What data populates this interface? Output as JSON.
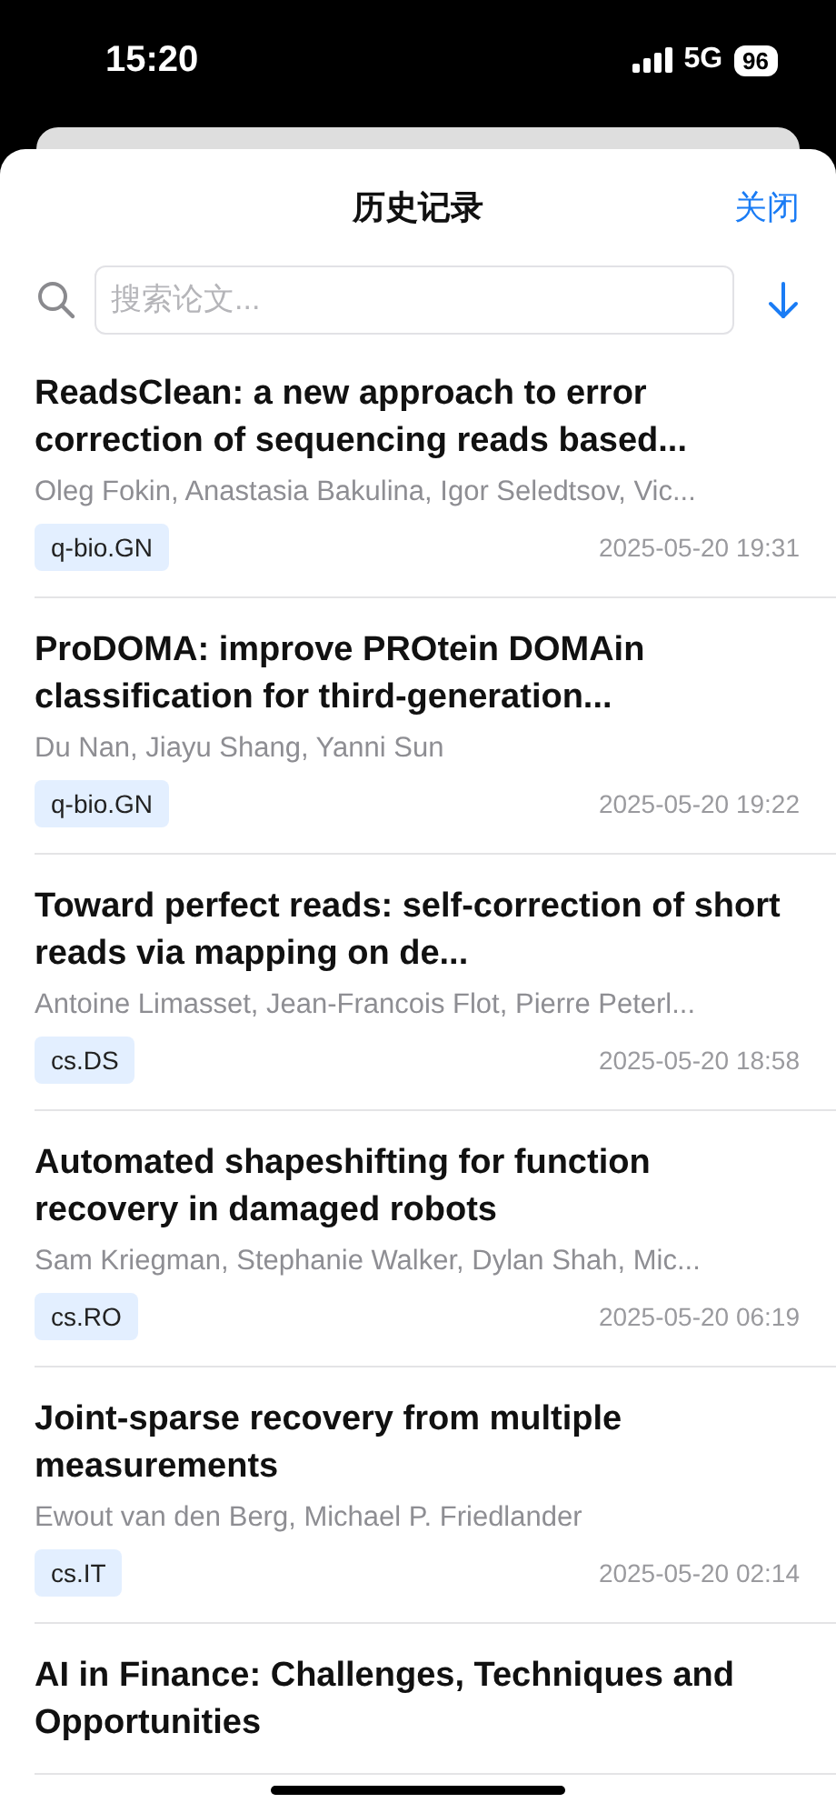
{
  "status_bar": {
    "time": "15:20",
    "network": "5G",
    "battery": "96"
  },
  "header": {
    "title": "历史记录",
    "close": "关闭"
  },
  "search": {
    "placeholder": "搜索论文..."
  },
  "papers": [
    {
      "title": "ReadsClean: a new approach to error correction of sequencing reads based...",
      "authors": "Oleg Fokin, Anastasia Bakulina, Igor Seledtsov, Vic...",
      "category": "q-bio.GN",
      "date": "2025-05-20 19:31"
    },
    {
      "title": "ProDOMA: improve PROtein DOMAin classification for third-generation...",
      "authors": "Du Nan, Jiayu Shang, Yanni Sun",
      "category": "q-bio.GN",
      "date": "2025-05-20 19:22"
    },
    {
      "title": "Toward perfect reads: self-correction of short reads via mapping on de...",
      "authors": "Antoine Limasset, Jean-Francois Flot, Pierre Peterl...",
      "category": "cs.DS",
      "date": "2025-05-20 18:58"
    },
    {
      "title": "Automated shapeshifting for function recovery in damaged robots",
      "authors": "Sam Kriegman, Stephanie Walker, Dylan Shah, Mic...",
      "category": "cs.RO",
      "date": "2025-05-20 06:19"
    },
    {
      "title": "Joint-sparse recovery from multiple measurements",
      "authors": "Ewout van den Berg, Michael P. Friedlander",
      "category": "cs.IT",
      "date": "2025-05-20 02:14"
    },
    {
      "title": "AI in Finance: Challenges, Techniques and Opportunities"
    }
  ]
}
